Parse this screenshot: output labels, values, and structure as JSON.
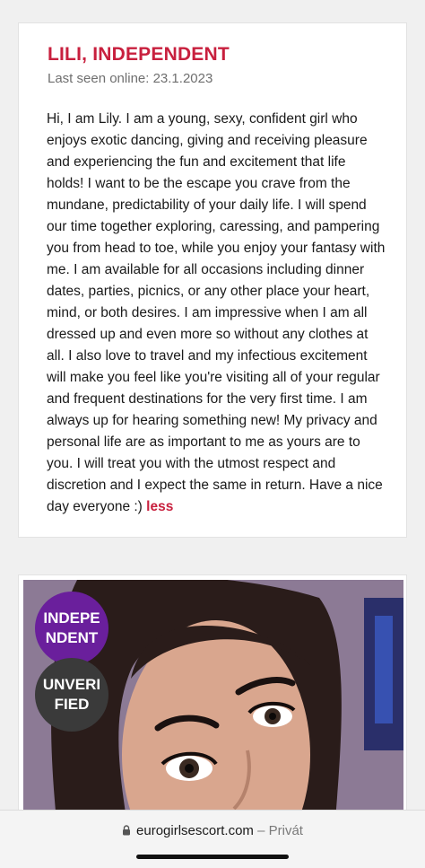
{
  "profile": {
    "title": "LILI, INDEPENDENT",
    "last_seen": "Last seen online: 23.1.2023",
    "bio": "Hi, I am Lily. I am a young, sexy, confident girl who enjoys exotic dancing, giving and receiving pleasure and experiencing the fun and excitement that life holds! I want to be the escape you crave from the mundane, predictability of your daily life. I will spend our time together exploring, caressing, and pampering you from head to toe, while you enjoy your fantasy with me. I am available for all occasions including dinner dates, parties, picnics, or any other place your heart, mind, or both desires. I am impressive when I am all dressed up and even more so without any clothes at all. I also love to travel and my infectious excitement will make you feel like you're visiting all of your regular and frequent destinations for the very first time. I am always up for hearing something new! My privacy and personal life are as important to me as yours are to you. I will treat you with the utmost respect and discretion and I expect the same in return. Have a nice day everyone :)",
    "less_link": "less"
  },
  "photo": {
    "badge_independent": "INDEPE NDENT",
    "badge_unverified": "UNVERI FIED"
  },
  "browser": {
    "domain": "eurogirlsescort.com",
    "separator": "–",
    "mode": "Privát"
  },
  "colors": {
    "accent": "#c8203e",
    "badge_purple": "#6a1f9c",
    "badge_dark": "#3a3a3a"
  }
}
